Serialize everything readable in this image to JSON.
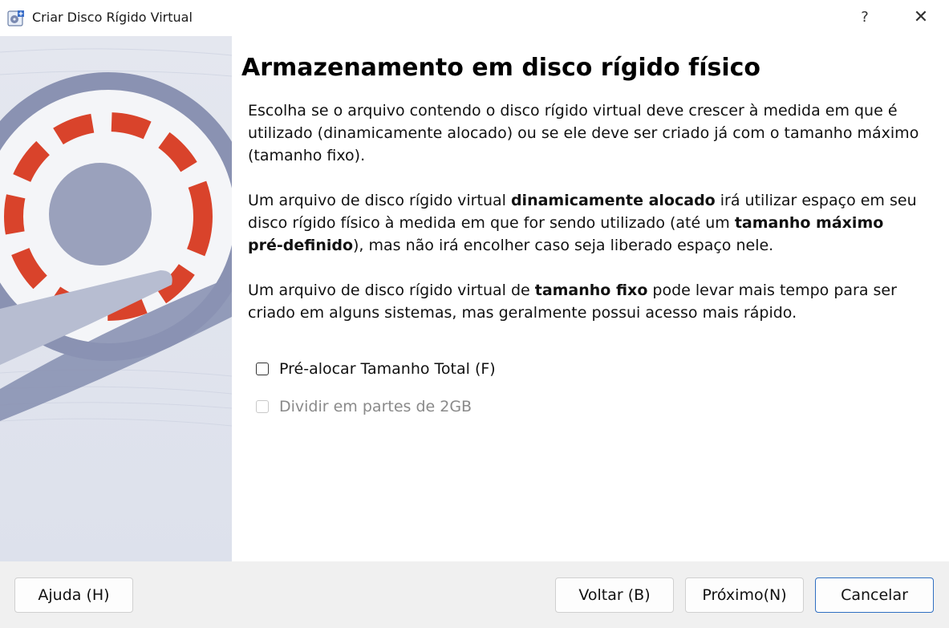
{
  "window": {
    "title": "Criar Disco Rígido Virtual",
    "help_glyph": "?",
    "close_glyph": "✕"
  },
  "content": {
    "heading": "Armazenamento em disco rígido físico",
    "paragraph1": "Escolha se o arquivo contendo o disco rígido virtual deve crescer à medida em que é utilizado (dinamicamente alocado) ou se ele deve ser criado já com o tamanho máximo (tamanho fixo).",
    "paragraph2": {
      "part1": "Um arquivo de disco rígido virtual ",
      "bold1": "dinamicamente alocado",
      "part2": " irá utilizar espaço em seu disco rígido físico à medida em que for sendo utilizado (até um ",
      "bold2": "tamanho máximo pré-definido",
      "part3": "), mas não irá encolher caso seja liberado espaço nele."
    },
    "paragraph3": {
      "part1": "Um arquivo de disco rígido virtual de ",
      "bold1": "tamanho fixo",
      "part2": " pode levar mais tempo para ser criado em alguns sistemas, mas geralmente possui acesso mais rápido."
    }
  },
  "options": [
    {
      "label": "Pré-alocar Tamanho Total (F)",
      "checked": false,
      "enabled": true
    },
    {
      "label": "Dividir em partes de 2GB",
      "checked": false,
      "enabled": false
    }
  ],
  "buttons": {
    "help": "Ajuda (H)",
    "back": "Voltar (B)",
    "next": "Próximo(N)",
    "cancel": "Cancelar"
  },
  "colors": {
    "accent": "#2f6fc2",
    "disk_stripe": "#d9432b",
    "disk_body": "#8a92b2",
    "side_bg": "#dfe3ee"
  },
  "icons": {
    "app": "virtualbox-disk-icon",
    "side": "hard-disk-illustration"
  }
}
